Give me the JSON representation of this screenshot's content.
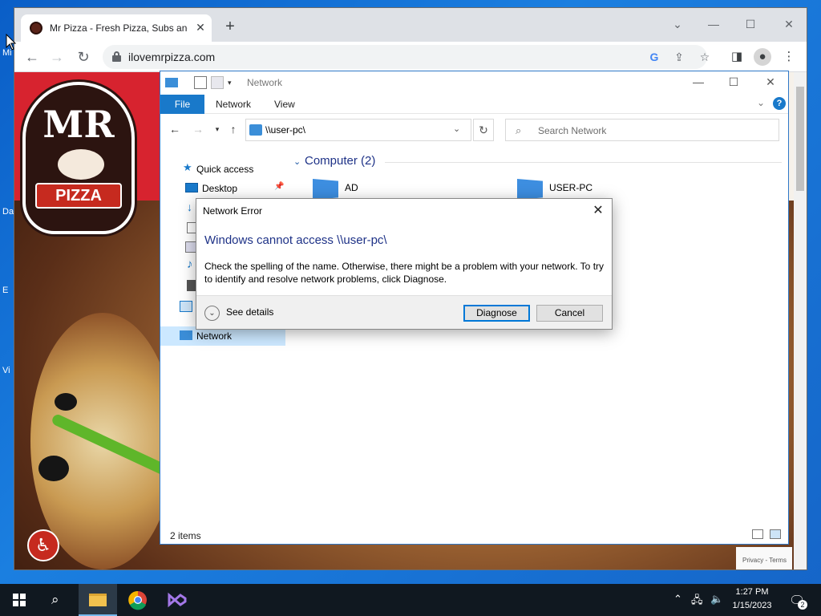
{
  "desktop": {
    "icon_labels": [
      "Mi",
      "Da",
      "E",
      "Vi"
    ]
  },
  "browser": {
    "tab_title": "Mr Pizza - Fresh Pizza, Subs and",
    "url": "ilovemrpizza.com",
    "icons": {
      "back": "arrow-left-icon",
      "forward": "arrow-right-icon",
      "reload": "reload-icon",
      "google": "google-icon",
      "share": "share-icon",
      "bookmark": "star-icon",
      "sidepanel": "side-panel-icon",
      "profile": "profile-icon",
      "menu": "kebab-menu-icon"
    },
    "page": {
      "logo_top": "MR",
      "logo_bottom": "PIZZA",
      "recaptcha_text": "Privacy - Terms"
    }
  },
  "explorer": {
    "title": "Network",
    "ribbon_tabs": [
      "File",
      "Network",
      "View"
    ],
    "address": "\\\\user-pc\\",
    "search_placeholder": "Search Network",
    "nav_items": [
      {
        "label": "Quick access"
      },
      {
        "label": "Desktop"
      },
      {
        "label": "Network"
      }
    ],
    "group_title": "Computer (2)",
    "computers": [
      "AD",
      "USER-PC"
    ],
    "status": "2 items"
  },
  "dialog": {
    "title": "Network Error",
    "heading": "Windows cannot access \\\\user-pc\\",
    "body": "Check the spelling of the name. Otherwise, there might be a problem with your network. To try to identify and resolve network problems, click Diagnose.",
    "see_details": "See details",
    "diagnose": "Diagnose",
    "cancel": "Cancel"
  },
  "taskbar": {
    "time": "1:27 PM",
    "date": "1/15/2023",
    "notification_count": "2"
  },
  "colors": {
    "accent": "#0078d7",
    "explorer_file_tab": "#1979ca",
    "heading_blue": "#1e3287",
    "pizza_red": "#d7232f"
  }
}
